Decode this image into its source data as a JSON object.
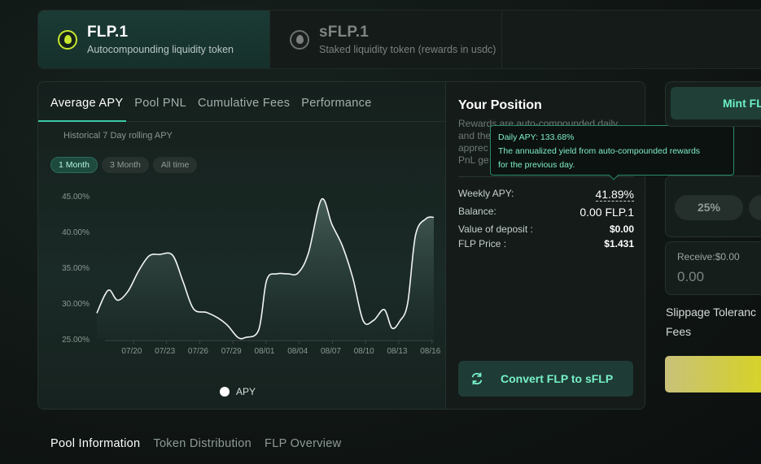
{
  "token_tabs": [
    {
      "name": "FLP.1",
      "subtitle": "Autocompounding liquidity token",
      "icon": "flp-drop-icon",
      "active": true
    },
    {
      "name": "sFLP.1",
      "subtitle": "Staked liquidity token (rewards in usdc)",
      "icon": "sflp-drop-icon",
      "active": false
    }
  ],
  "chart_tabs": [
    "Average APY",
    "Pool PNL",
    "Cumulative Fees",
    "Performance"
  ],
  "chart_subtitle": "Historical 7 Day rolling APY",
  "ranges": [
    "1 Month",
    "3 Month",
    "All time"
  ],
  "chart_data": {
    "type": "area",
    "title": "",
    "x": [
      "07/20",
      "07/23",
      "07/26",
      "07/29",
      "08/01",
      "08/04",
      "08/07",
      "08/10",
      "08/13",
      "08/16"
    ],
    "yticks": [
      "45.00%",
      "40.00%",
      "35.00%",
      "30.00%",
      "25.00%"
    ],
    "ylim": [
      25,
      45
    ],
    "series": [
      {
        "name": "APY",
        "points": [
          [
            0,
            28.6
          ],
          [
            0.3,
            31.1
          ],
          [
            0.5,
            31.8
          ],
          [
            0.8,
            30.4
          ],
          [
            1.2,
            31.7
          ],
          [
            1.6,
            34.5
          ],
          [
            2.0,
            36.6
          ],
          [
            2.4,
            36.8
          ],
          [
            2.9,
            36.7
          ],
          [
            3.3,
            33.0
          ],
          [
            3.7,
            29.2
          ],
          [
            4.2,
            28.7
          ],
          [
            4.6,
            28.0
          ],
          [
            5.0,
            26.9
          ],
          [
            5.4,
            25.2
          ],
          [
            5.7,
            25.2
          ],
          [
            6.2,
            26.3
          ],
          [
            6.5,
            33.2
          ],
          [
            6.9,
            34.1
          ],
          [
            7.3,
            34.1
          ],
          [
            7.7,
            34.2
          ],
          [
            8.1,
            37.0
          ],
          [
            8.6,
            44.5
          ],
          [
            9.0,
            41.0
          ],
          [
            9.4,
            38.0
          ],
          [
            9.8,
            33.5
          ],
          [
            10.2,
            27.5
          ],
          [
            10.6,
            27.6
          ],
          [
            11.0,
            29.1
          ],
          [
            11.3,
            26.5
          ],
          [
            11.6,
            27.5
          ],
          [
            11.9,
            30.0
          ],
          [
            12.2,
            39.5
          ],
          [
            12.6,
            41.8
          ],
          [
            12.9,
            42.0
          ]
        ]
      }
    ],
    "legend": "bottom-center"
  },
  "position": {
    "title": "Your Position",
    "description": "Rewards are auto-compounded daily and the ... appreciate ... PnL ge...",
    "desc_lines": [
      "Rewards are auto-compounded daily",
      "and the",
      "apprec",
      "PnL ge"
    ],
    "rows": [
      {
        "label": "Weekly APY:",
        "value": "41.89%"
      },
      {
        "label": "Balance:",
        "value": "0.00 FLP.1"
      },
      {
        "label": "Value of deposit :",
        "value": "$0.00"
      },
      {
        "label": "FLP Price :",
        "value": "$1.431"
      }
    ],
    "convert_label": "Convert FLP to sFLP"
  },
  "tooltip": {
    "line1": "Daily APY: 133.68%",
    "line2": "The annualized yield from auto-compounded rewards",
    "line3": "for the previous day."
  },
  "right": {
    "mint_label": "Mint FL",
    "pct_label": "25%",
    "receive_label": "Receive:$0.00",
    "receive_value": "0.00",
    "slippage_label": "Slippage Toleranc",
    "fees_label": "Fees"
  },
  "bottom_tabs": [
    "Pool Information",
    "Token Distribution",
    "FLP Overview"
  ],
  "colors": {
    "accent": "#3bc9a5",
    "lime": "#c7e62f",
    "tooltip_text": "#7ff0c5"
  }
}
